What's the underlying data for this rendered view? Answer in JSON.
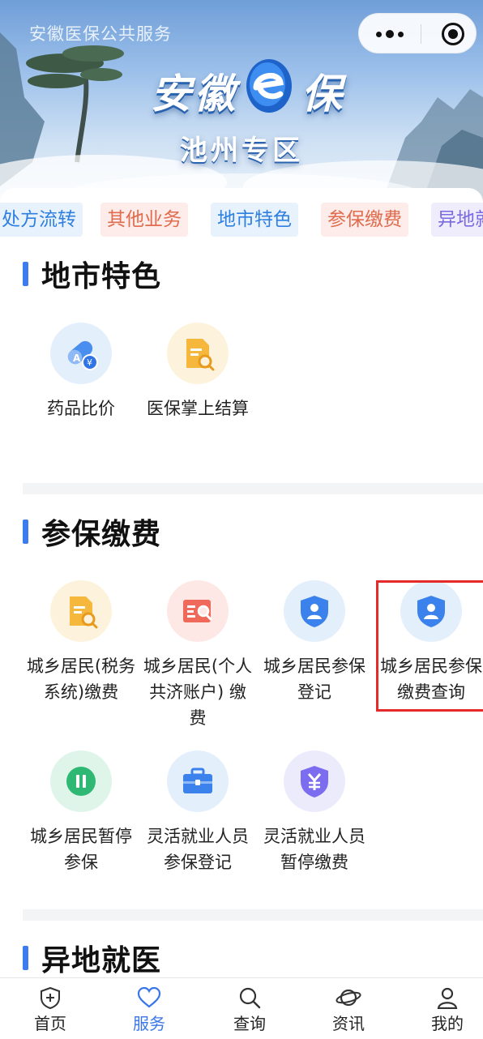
{
  "header": {
    "mini_program_name": "安徽医保公共服务",
    "brand_left": "安徽",
    "brand_right": "保",
    "zone": "池州专区",
    "capsule": {
      "more_icon": "more-dots-icon",
      "close_icon": "close-target-icon"
    }
  },
  "tabs": [
    {
      "label": "处方流转",
      "color": "#2f7fe0",
      "bg": "#e8f2fc"
    },
    {
      "label": "其他业务",
      "color": "#e06b4d",
      "bg": "#fdecea"
    },
    {
      "label": "地市特色",
      "color": "#2f7fe0",
      "bg": "#e8f2fc"
    },
    {
      "label": "参保缴费",
      "color": "#e06b4d",
      "bg": "#fdecea"
    },
    {
      "label": "异地就",
      "color": "#7a69e0",
      "bg": "#efedfc"
    }
  ],
  "sections": [
    {
      "title": "地市特色",
      "items": [
        {
          "label": "药品比价",
          "icon": "pill-price-icon"
        },
        {
          "label": "医保掌上结算",
          "icon": "doc-search-icon"
        }
      ]
    },
    {
      "title": "参保缴费",
      "items": [
        {
          "label": "城乡居民(税务系统)缴费",
          "icon": "doc-search-icon"
        },
        {
          "label": "城乡居民(个人共济账户) 缴费",
          "icon": "id-card-search-icon"
        },
        {
          "label": "城乡居民参保登记",
          "icon": "shield-user-icon"
        },
        {
          "label": "城乡居民参保缴费查询",
          "icon": "shield-user-icon"
        },
        {
          "label": "城乡居民暂停参保",
          "icon": "pause-icon"
        },
        {
          "label": "灵活就业人员参保登记",
          "icon": "briefcase-icon"
        },
        {
          "label": "灵活就业人员暂停缴费",
          "icon": "shield-yuan-icon"
        }
      ]
    },
    {
      "title": "异地就医"
    }
  ],
  "bottom_nav": [
    {
      "label": "首页",
      "icon": "home-shield-icon",
      "active": false
    },
    {
      "label": "服务",
      "icon": "heart-icon",
      "active": true
    },
    {
      "label": "查询",
      "icon": "search-icon",
      "active": false
    },
    {
      "label": "资讯",
      "icon": "planet-icon",
      "active": false
    },
    {
      "label": "我的",
      "icon": "user-icon",
      "active": false
    }
  ],
  "colors": {
    "accent": "#3a76e8",
    "section_bar": "#3d7cf0",
    "highlight_border": "#e52a2a"
  }
}
